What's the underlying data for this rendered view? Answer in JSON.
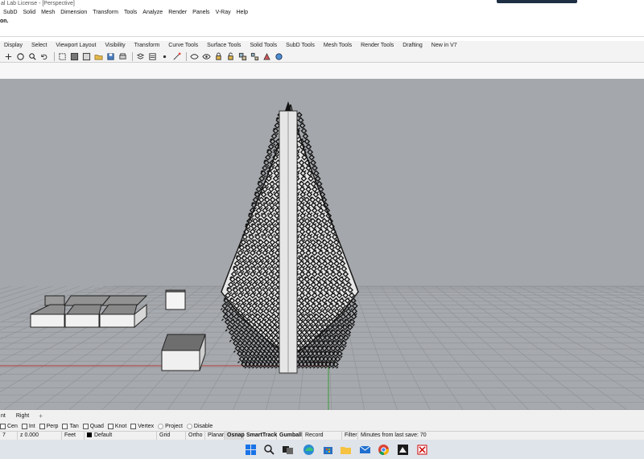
{
  "window": {
    "title": "al Lab License - [Perspective]"
  },
  "menu": [
    "SubD",
    "Solid",
    "Mesh",
    "Dimension",
    "Transform",
    "Tools",
    "Analyze",
    "Render",
    "Panels",
    "V-Ray",
    "Help"
  ],
  "command": {
    "prompt": "on."
  },
  "tabs": [
    "Display",
    "Select",
    "Viewport Layout",
    "Visibility",
    "Transform",
    "Curve Tools",
    "Surface Tools",
    "Solid Tools",
    "SubD Tools",
    "Mesh Tools",
    "Render Tools",
    "Drafting",
    "New in V7"
  ],
  "toolbar_icons": [
    "pan-icon",
    "rotate-view-icon",
    "zoom-icon",
    "undo-view-icon",
    "zoom-window-icon",
    "shaded-view-icon",
    "rendered-view-icon",
    "open-icon",
    "save-icon",
    "print-icon",
    "layer-icon",
    "properties-icon",
    "point-icon",
    "snap-icon",
    "hide-icon",
    "show-icon",
    "lock-icon",
    "unlock-icon",
    "group-icon",
    "ungroup-icon",
    "tools-icon",
    "render-icon"
  ],
  "viewport_tabs": {
    "tab1": "nt",
    "tab2": "Right",
    "add": "+"
  },
  "osnap": [
    {
      "label": "Cen",
      "type": "box"
    },
    {
      "label": "Int",
      "type": "box"
    },
    {
      "label": "Perp",
      "type": "box"
    },
    {
      "label": "Tan",
      "type": "box"
    },
    {
      "label": "Quad",
      "type": "box"
    },
    {
      "label": "Knot",
      "type": "box"
    },
    {
      "label": "Vertex",
      "type": "box"
    },
    {
      "label": "Project",
      "type": "circle"
    },
    {
      "label": "Disable",
      "type": "circle"
    }
  ],
  "status": {
    "x": "7",
    "z": "z 0.000",
    "units": "Feet",
    "layer": "Default",
    "grid_snap": "Grid Snap",
    "ortho": "Ortho",
    "planar": "Planar",
    "osnap": "Osnap",
    "smarttrack": "SmartTrack",
    "gumball": "Gumball",
    "record_history": "Record History",
    "filter": "Filter",
    "autosave": "Minutes from last save: 70"
  },
  "taskbar_icons": [
    "windows-start-icon",
    "search-icon",
    "task-view-icon",
    "edge-icon",
    "store-icon",
    "file-explorer-icon",
    "mail-icon",
    "chrome-icon",
    "rhino-icon",
    "snipping-tool-icon"
  ],
  "colors": {
    "viewport_bg": "#a4a7ab",
    "grid_line": "#8d9094",
    "x_axis": "#b23a3a",
    "y_axis": "#3a9a3a",
    "taskbar": "#dfe3ea"
  }
}
